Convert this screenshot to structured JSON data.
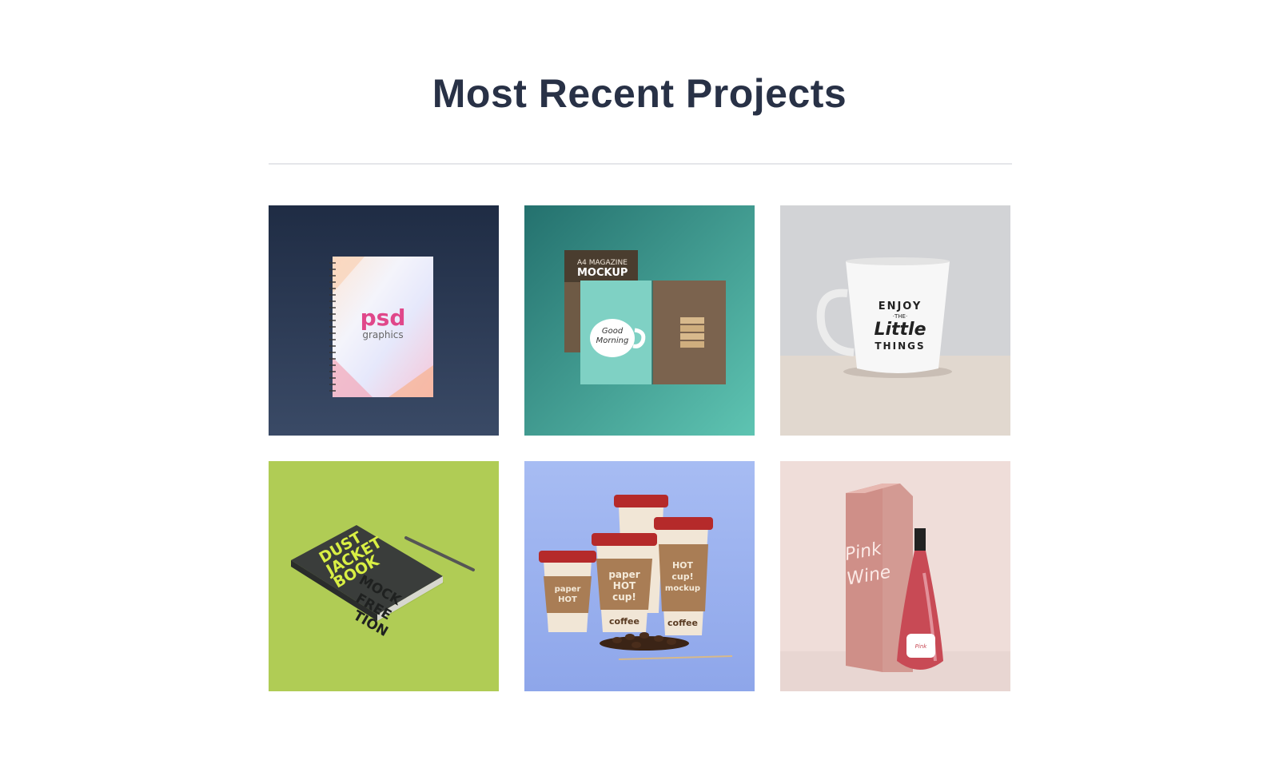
{
  "section": {
    "title": "Most Recent Projects"
  },
  "projects": [
    {
      "mock_text": [
        "psd",
        "graphics"
      ]
    },
    {
      "mock_text": [
        "A4 MAGAZINE",
        "MOCKUP",
        "Good",
        "Morning"
      ]
    },
    {
      "mock_text": [
        "ENJOY",
        "·THE·",
        "Little",
        "THINGS"
      ]
    },
    {
      "mock_text": [
        "DUST",
        "JACKET",
        "BOOK",
        "MOCK",
        "FREE",
        "TION"
      ]
    },
    {
      "mock_text": [
        "paper",
        "HOT",
        "cup!",
        "mockup",
        "coffee"
      ]
    },
    {
      "mock_text": [
        "Pink",
        "Wine"
      ]
    }
  ],
  "colors": {
    "title": "#283146",
    "divider": "#e5e6ea",
    "notebook_bg": "#2b3a55",
    "magazine_bg": "#3a9e97",
    "mug_bg": "#d2d3d6",
    "book_bg": "#b0cc55",
    "cups_bg": "#9db3f0",
    "wine_bg": "#efddd9"
  }
}
